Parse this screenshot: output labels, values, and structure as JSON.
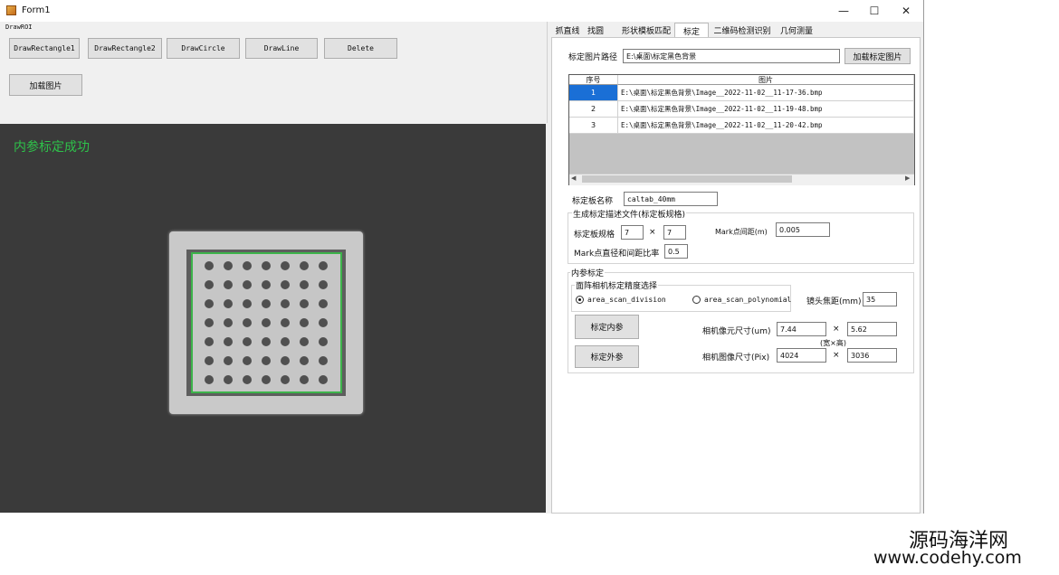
{
  "window": {
    "title": "Form1",
    "controls": {
      "minimize": "—",
      "maximize": "☐",
      "close": "✕"
    }
  },
  "left": {
    "group_label": "DrawROI",
    "draw_buttons": [
      "DrawRectangle1",
      "DrawRectangle2",
      "DrawCircle",
      "DrawLine",
      "Delete"
    ],
    "load_image_button": "加载图片",
    "status_text": "内参标定成功"
  },
  "tabs": [
    "抓直线",
    "找圆",
    "形状模板匹配",
    "标定",
    "二维码检测识别",
    "几何测量"
  ],
  "active_tab": "标定",
  "calib": {
    "image_path_label": "标定图片路径",
    "image_path_value": "E:\\桌面\\标定黑色背景",
    "load_calib_images_button": "加载标定图片",
    "grid": {
      "columns": [
        "序号",
        "图片"
      ],
      "rows": [
        {
          "index": "1",
          "path": "E:\\桌面\\标定黑色背景\\Image__2022-11-02__11-17-36.bmp",
          "selected": true
        },
        {
          "index": "2",
          "path": "E:\\桌面\\标定黑色背景\\Image__2022-11-02__11-19-48.bmp",
          "selected": false
        },
        {
          "index": "3",
          "path": "E:\\桌面\\标定黑色背景\\Image__2022-11-02__11-20-42.bmp",
          "selected": false
        }
      ]
    },
    "board_name_label": "标定板名称",
    "board_name_value": "caltab_40mm",
    "desc_group_title": "生成标定描述文件(标定板规格)",
    "board_spec_label": "标定板规格",
    "board_spec_x": "7",
    "board_spec_times": "×",
    "board_spec_y": "7",
    "mark_spacing_label": "Mark点间距(m)",
    "mark_spacing_value": "0.005",
    "mark_ratio_label": "Mark点直径和间距比率",
    "mark_ratio_value": "0.5",
    "intrinsic_group_title": "内参标定",
    "camera_precision_title": "面阵相机标定精度选择",
    "radio_division": "area_scan_division",
    "radio_polynomial": "area_scan_polynomial",
    "focal_label": "镜头焦距(mm)",
    "focal_value": "35",
    "calib_intrinsic_button": "标定内参",
    "calib_extrinsic_button": "标定外参",
    "pixel_size_label": "相机像元尺寸(um)",
    "pixel_w": "7.44",
    "pixel_h": "5.62",
    "wh_hint": "(宽×高)",
    "image_size_label": "相机图像尺寸(Pix)",
    "image_w": "4024",
    "image_h": "3036"
  },
  "watermark": {
    "cn": "源码海洋网",
    "url": "www.codehy.com"
  },
  "colors": {
    "status_green": "#2ec24a",
    "board_border": "#3cb34a",
    "selection": "#1a6fd6"
  }
}
